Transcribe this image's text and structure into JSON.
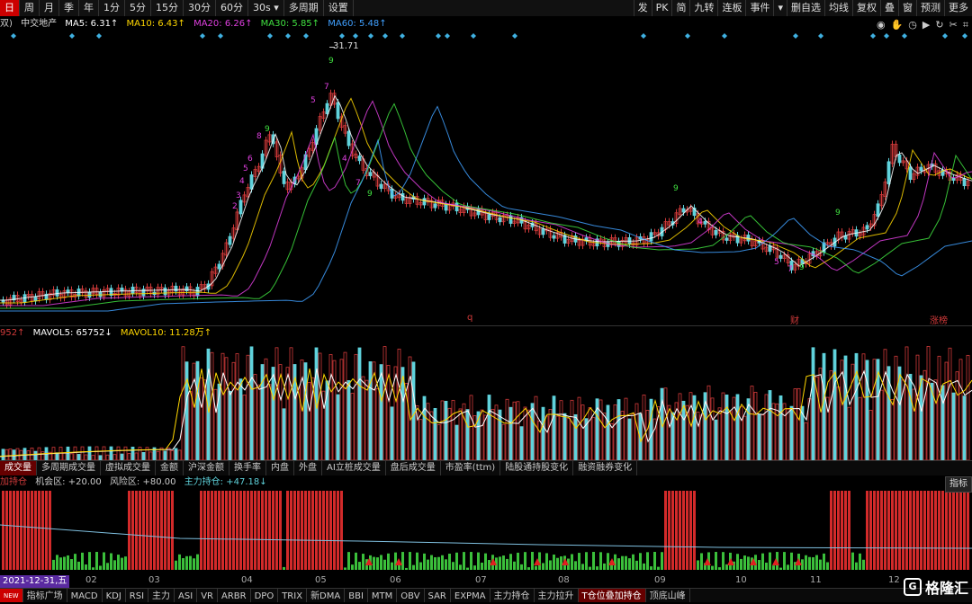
{
  "toolbar": {
    "periods": [
      {
        "label": "日",
        "active": true
      },
      {
        "label": "周"
      },
      {
        "label": "月"
      },
      {
        "label": "季"
      },
      {
        "label": "年"
      },
      {
        "label": "1分"
      },
      {
        "label": "5分"
      },
      {
        "label": "15分"
      },
      {
        "label": "30分"
      },
      {
        "label": "60分"
      },
      {
        "label": "30s ▾"
      },
      {
        "label": "多周期"
      },
      {
        "label": "设置"
      }
    ],
    "right": [
      "发",
      "PK",
      "简",
      "九转",
      "连板",
      "事件",
      "▾",
      "删自选",
      "均线",
      "复权",
      "叠",
      "窗",
      "预测",
      "更多"
    ]
  },
  "ma_legend": {
    "prefix": "双)",
    "name": "中交地产",
    "ma5": "MA5: 6.31↑",
    "ma10": "MA10: 6.43↑",
    "ma20": "MA20: 6.26↑",
    "ma30": "MA30: 5.85↑",
    "ma60": "MA60: 5.48↑"
  },
  "price_panel": {
    "peak_label": "31.71",
    "marker_q": "q",
    "marker_cai": "财",
    "marker_longhu": "涨榜"
  },
  "vol_legend": {
    "prefix": "952↑",
    "mavol5": "MAVOL5: 65752↓",
    "mavol10": "MAVOL10: 11.28万↑"
  },
  "indicator_tabs": [
    {
      "label": "成交量",
      "active": true
    },
    {
      "label": "多周期成交量"
    },
    {
      "label": "虚拟成交量"
    },
    {
      "label": "金额"
    },
    {
      "label": "沪深金额"
    },
    {
      "label": "换手率"
    },
    {
      "label": "内盘"
    },
    {
      "label": "外盘"
    },
    {
      "label": "AI立桩成交量"
    },
    {
      "label": "盘后成交量"
    },
    {
      "label": "市盈率(ttm)"
    },
    {
      "label": "陆股通持股变化"
    },
    {
      "label": "融资融券变化"
    }
  ],
  "hold_legend": {
    "prefix": "加持仓",
    "chance": "机会区: +20.00",
    "risk": "风险区: +80.00",
    "main": "主力持仓: +47.18↓"
  },
  "index_button": "指标",
  "date_label": "2021-12-31,五",
  "months": [
    "02",
    "03",
    "04",
    "05",
    "06",
    "07",
    "08",
    "09",
    "10",
    "11",
    "12"
  ],
  "bottom_tabs": [
    {
      "label": "NEW"
    },
    {
      "label": "指标广场"
    },
    {
      "label": "MACD"
    },
    {
      "label": "KDJ"
    },
    {
      "label": "RSI"
    },
    {
      "label": "主力"
    },
    {
      "label": "ASI"
    },
    {
      "label": "VR"
    },
    {
      "label": "ARBR"
    },
    {
      "label": "DPO"
    },
    {
      "label": "TRIX"
    },
    {
      "label": "新DMA"
    },
    {
      "label": "BBI"
    },
    {
      "label": "MTM"
    },
    {
      "label": "OBV"
    },
    {
      "label": "SAR"
    },
    {
      "label": "EXPMA"
    },
    {
      "label": "主力持仓"
    },
    {
      "label": "主力拉升"
    },
    {
      "label": "T仓位叠加持仓",
      "active": true
    },
    {
      "label": "顶底山峰"
    }
  ],
  "brand": "格隆汇",
  "colors": {
    "up": "#d23a3a",
    "down": "#5fd3dc",
    "ma5": "#ffffff",
    "ma10": "#ffd700",
    "ma20": "#e040e0",
    "ma30": "#40e040",
    "ma60": "#40a0ff",
    "hold": "#d22a2a",
    "chance_bar": "#3bbf3b"
  }
}
